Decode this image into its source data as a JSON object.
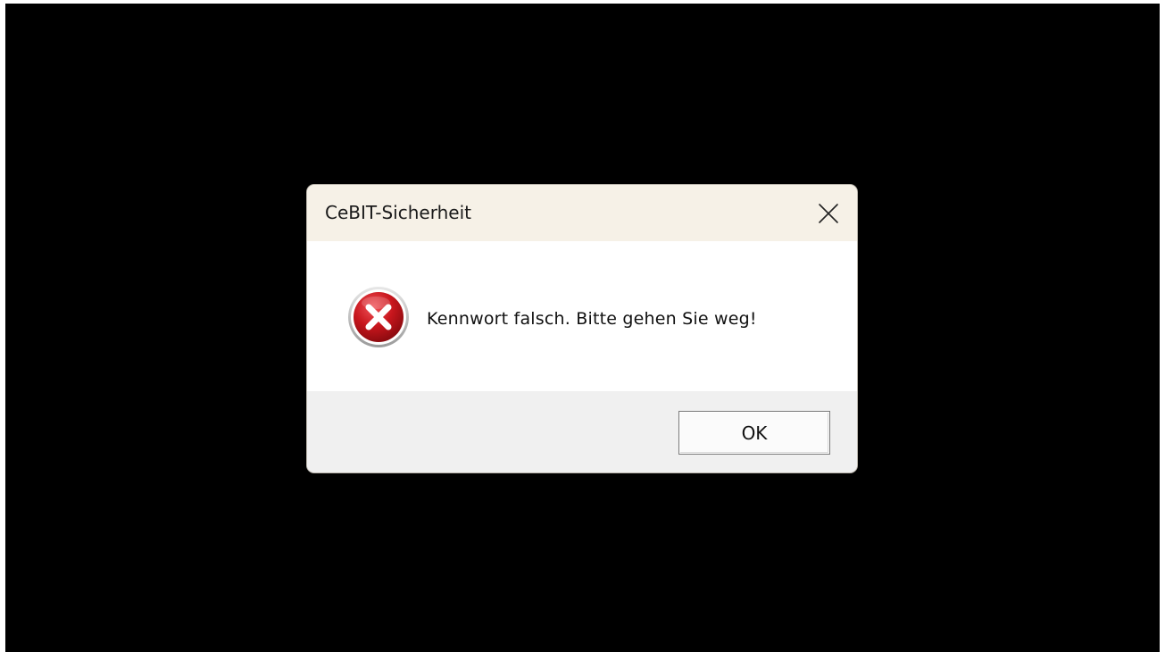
{
  "dialog": {
    "title": "CeBIT-Sicherheit",
    "message": "Kennwort falsch. Bitte gehen Sie weg!",
    "ok_label": "OK",
    "icon": "error-icon",
    "close_icon": "close-icon"
  },
  "colors": {
    "backdrop": "#000000",
    "titlebar": "#f6f1e7",
    "content": "#ffffff",
    "footer": "#f0f0f0",
    "error_red": "#c4161c"
  }
}
